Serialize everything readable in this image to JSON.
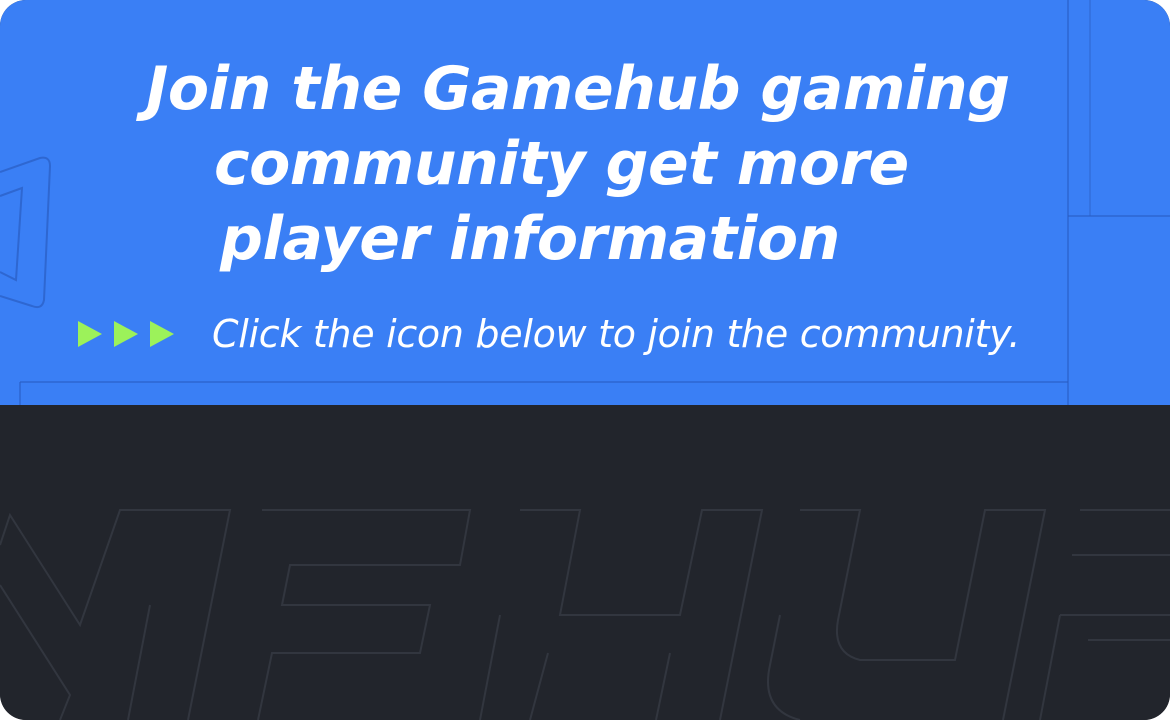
{
  "banner": {
    "headline_lines": [
      "Join the Gamehub gaming",
      "community get more",
      "player information"
    ],
    "cta_text": "Click the icon below to join the community.",
    "arrow_icons": [
      "play-arrow-icon",
      "play-arrow-icon",
      "play-arrow-icon"
    ]
  },
  "colors": {
    "banner_background": "#3a7ff5",
    "bottom_background": "#22252c",
    "arrow_accent": "#9cf25a",
    "text": "#ffffff"
  },
  "watermark": {
    "text": "MEHUB"
  }
}
